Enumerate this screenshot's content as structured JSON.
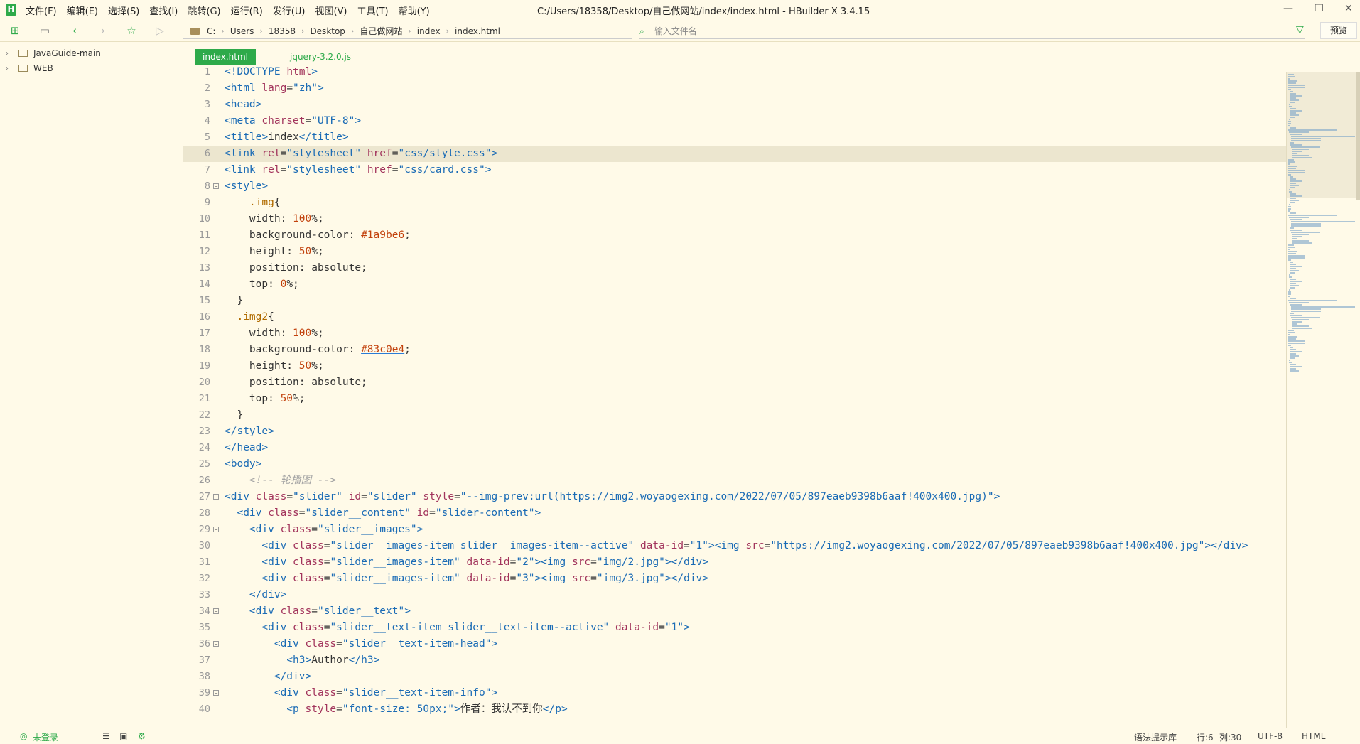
{
  "app": {
    "window_title": "C:/Users/18358/Desktop/自己做网站/index/index.html - HBuilder X 3.4.15",
    "logo_letter": "H"
  },
  "menu": [
    "文件(F)",
    "编辑(E)",
    "选择(S)",
    "查找(I)",
    "跳转(G)",
    "运行(R)",
    "发行(U)",
    "视图(V)",
    "工具(T)",
    "帮助(Y)"
  ],
  "toolbar": {
    "breadcrumb": [
      "C:",
      "Users",
      "18358",
      "Desktop",
      "自己做网站",
      "index",
      "index.html"
    ],
    "file_filter_placeholder": "输入文件名",
    "preview_label": "预览"
  },
  "sidebar": {
    "items": [
      {
        "label": "JavaGuide-main"
      },
      {
        "label": "WEB"
      }
    ]
  },
  "tabs": [
    {
      "label": "index.html",
      "active": true
    },
    {
      "label": "jquery-3.2.0.js",
      "active": false
    }
  ],
  "editor": {
    "current_line": 6,
    "lines": [
      {
        "n": "1",
        "fold": "",
        "tokens": [
          [
            "tg",
            "<!DOCTYPE "
          ],
          [
            "at",
            "html"
          ],
          [
            "tg",
            ">"
          ]
        ]
      },
      {
        "n": "2",
        "fold": "",
        "tokens": [
          [
            "tg",
            "<html "
          ],
          [
            "at",
            "lang"
          ],
          [
            "tx",
            "="
          ],
          [
            "st",
            "\"zh\""
          ],
          [
            "tg",
            ">"
          ]
        ]
      },
      {
        "n": "3",
        "fold": "",
        "tokens": [
          [
            "tg",
            "<head>"
          ]
        ]
      },
      {
        "n": "4",
        "fold": "",
        "tokens": [
          [
            "tg",
            "<meta "
          ],
          [
            "at",
            "charset"
          ],
          [
            "tx",
            "="
          ],
          [
            "st",
            "\"UTF-8\""
          ],
          [
            "tg",
            ">"
          ]
        ]
      },
      {
        "n": "5",
        "fold": "",
        "tokens": [
          [
            "tg",
            "<title>"
          ],
          [
            "tx",
            "index"
          ],
          [
            "tg",
            "</title>"
          ]
        ]
      },
      {
        "n": "6",
        "fold": "",
        "tokens": [
          [
            "tg",
            "<link "
          ],
          [
            "at",
            "rel"
          ],
          [
            "tx",
            "="
          ],
          [
            "st",
            "\"stylesheet\" "
          ],
          [
            "at",
            "href"
          ],
          [
            "tx",
            "="
          ],
          [
            "st",
            "\"css/style.css\""
          ],
          [
            "tg",
            ">"
          ]
        ]
      },
      {
        "n": "7",
        "fold": "",
        "tokens": [
          [
            "tg",
            "<link "
          ],
          [
            "at",
            "rel"
          ],
          [
            "tx",
            "="
          ],
          [
            "st",
            "\"stylesheet\" "
          ],
          [
            "at",
            "href"
          ],
          [
            "tx",
            "="
          ],
          [
            "st",
            "\"css/card.css\""
          ],
          [
            "tg",
            ">"
          ]
        ]
      },
      {
        "n": "8",
        "fold": "⊟",
        "tokens": [
          [
            "tg",
            "<style>"
          ]
        ]
      },
      {
        "n": "9",
        "fold": "",
        "tokens": [
          [
            "tx",
            "    "
          ],
          [
            "sel",
            ".img"
          ],
          [
            "tx",
            "{"
          ]
        ]
      },
      {
        "n": "10",
        "fold": "",
        "tokens": [
          [
            "tx",
            "    width: "
          ],
          [
            "num",
            "100"
          ],
          [
            "tx",
            "%;"
          ]
        ]
      },
      {
        "n": "11",
        "fold": "",
        "tokens": [
          [
            "tx",
            "    background-color: "
          ],
          [
            "clr",
            "#1a9be6"
          ],
          [
            "tx",
            ";"
          ]
        ]
      },
      {
        "n": "12",
        "fold": "",
        "tokens": [
          [
            "tx",
            "    height: "
          ],
          [
            "num",
            "50"
          ],
          [
            "tx",
            "%;"
          ]
        ]
      },
      {
        "n": "13",
        "fold": "",
        "tokens": [
          [
            "tx",
            "    position: absolute;"
          ]
        ]
      },
      {
        "n": "14",
        "fold": "",
        "tokens": [
          [
            "tx",
            "    top: "
          ],
          [
            "num",
            "0"
          ],
          [
            "tx",
            "%;"
          ]
        ]
      },
      {
        "n": "15",
        "fold": "",
        "tokens": [
          [
            "tx",
            "  }"
          ]
        ]
      },
      {
        "n": "16",
        "fold": "",
        "tokens": [
          [
            "tx",
            "  "
          ],
          [
            "sel",
            ".img2"
          ],
          [
            "tx",
            "{"
          ]
        ]
      },
      {
        "n": "17",
        "fold": "",
        "tokens": [
          [
            "tx",
            "    width: "
          ],
          [
            "num",
            "100"
          ],
          [
            "tx",
            "%;"
          ]
        ]
      },
      {
        "n": "18",
        "fold": "",
        "tokens": [
          [
            "tx",
            "    background-color: "
          ],
          [
            "clr",
            "#83c0e4"
          ],
          [
            "tx",
            ";"
          ]
        ]
      },
      {
        "n": "19",
        "fold": "",
        "tokens": [
          [
            "tx",
            "    height: "
          ],
          [
            "num",
            "50"
          ],
          [
            "tx",
            "%;"
          ]
        ]
      },
      {
        "n": "20",
        "fold": "",
        "tokens": [
          [
            "tx",
            "    position: absolute;"
          ]
        ]
      },
      {
        "n": "21",
        "fold": "",
        "tokens": [
          [
            "tx",
            "    top: "
          ],
          [
            "num",
            "50"
          ],
          [
            "tx",
            "%;"
          ]
        ]
      },
      {
        "n": "22",
        "fold": "",
        "tokens": [
          [
            "tx",
            "  }"
          ]
        ]
      },
      {
        "n": "23",
        "fold": "",
        "tokens": [
          [
            "tg",
            "</style>"
          ]
        ]
      },
      {
        "n": "24",
        "fold": "",
        "tokens": [
          [
            "tg",
            "</head>"
          ]
        ]
      },
      {
        "n": "25",
        "fold": "",
        "tokens": [
          [
            "tg",
            "<body>"
          ]
        ]
      },
      {
        "n": "26",
        "fold": "",
        "tokens": [
          [
            "cm",
            "    <!-- 轮播图 -->"
          ]
        ]
      },
      {
        "n": "27",
        "fold": "⊟",
        "tokens": [
          [
            "tg",
            "<div "
          ],
          [
            "at",
            "class"
          ],
          [
            "tx",
            "="
          ],
          [
            "st",
            "\"slider\" "
          ],
          [
            "at",
            "id"
          ],
          [
            "tx",
            "="
          ],
          [
            "st",
            "\"slider\" "
          ],
          [
            "at",
            "style"
          ],
          [
            "tx",
            "="
          ],
          [
            "st",
            "\"--img-prev:url(https://img2.woyaogexing.com/2022/07/05/897eaeb9398b6aaf!400x400.jpg)\""
          ],
          [
            "tg",
            ">"
          ]
        ]
      },
      {
        "n": "28",
        "fold": "",
        "tokens": [
          [
            "tx",
            "  "
          ],
          [
            "tg",
            "<div "
          ],
          [
            "at",
            "class"
          ],
          [
            "tx",
            "="
          ],
          [
            "st",
            "\"slider__content\" "
          ],
          [
            "at",
            "id"
          ],
          [
            "tx",
            "="
          ],
          [
            "st",
            "\"slider-content\""
          ],
          [
            "tg",
            ">"
          ]
        ]
      },
      {
        "n": "29",
        "fold": "⊟",
        "tokens": [
          [
            "tx",
            "    "
          ],
          [
            "tg",
            "<div "
          ],
          [
            "at",
            "class"
          ],
          [
            "tx",
            "="
          ],
          [
            "st",
            "\"slider__images\""
          ],
          [
            "tg",
            ">"
          ]
        ]
      },
      {
        "n": "30",
        "fold": "",
        "tokens": [
          [
            "tx",
            "      "
          ],
          [
            "tg",
            "<div "
          ],
          [
            "at",
            "class"
          ],
          [
            "tx",
            "="
          ],
          [
            "st",
            "\"slider__images-item slider__images-item--active\" "
          ],
          [
            "at",
            "data-id"
          ],
          [
            "tx",
            "="
          ],
          [
            "st",
            "\"1\""
          ],
          [
            "tg",
            "><img "
          ],
          [
            "at",
            "src"
          ],
          [
            "tx",
            "="
          ],
          [
            "st",
            "\"https://img2.woyaogexing.com/2022/07/05/897eaeb9398b6aaf!400x400.jpg\""
          ],
          [
            "tg",
            "></div>"
          ]
        ]
      },
      {
        "n": "31",
        "fold": "",
        "tokens": [
          [
            "tx",
            "      "
          ],
          [
            "tg",
            "<div "
          ],
          [
            "at",
            "class"
          ],
          [
            "tx",
            "="
          ],
          [
            "st",
            "\"slider__images-item\" "
          ],
          [
            "at",
            "data-id"
          ],
          [
            "tx",
            "="
          ],
          [
            "st",
            "\"2\""
          ],
          [
            "tg",
            "><img "
          ],
          [
            "at",
            "src"
          ],
          [
            "tx",
            "="
          ],
          [
            "st",
            "\"img/2.jpg\""
          ],
          [
            "tg",
            "></div>"
          ]
        ]
      },
      {
        "n": "32",
        "fold": "",
        "tokens": [
          [
            "tx",
            "      "
          ],
          [
            "tg",
            "<div "
          ],
          [
            "at",
            "class"
          ],
          [
            "tx",
            "="
          ],
          [
            "st",
            "\"slider__images-item\" "
          ],
          [
            "at",
            "data-id"
          ],
          [
            "tx",
            "="
          ],
          [
            "st",
            "\"3\""
          ],
          [
            "tg",
            "><img "
          ],
          [
            "at",
            "src"
          ],
          [
            "tx",
            "="
          ],
          [
            "st",
            "\"img/3.jpg\""
          ],
          [
            "tg",
            "></div>"
          ]
        ]
      },
      {
        "n": "33",
        "fold": "",
        "tokens": [
          [
            "tx",
            "    "
          ],
          [
            "tg",
            "</div>"
          ]
        ]
      },
      {
        "n": "34",
        "fold": "⊟",
        "tokens": [
          [
            "tx",
            "    "
          ],
          [
            "tg",
            "<div "
          ],
          [
            "at",
            "class"
          ],
          [
            "tx",
            "="
          ],
          [
            "st",
            "\"slider__text\""
          ],
          [
            "tg",
            ">"
          ]
        ]
      },
      {
        "n": "35",
        "fold": "",
        "tokens": [
          [
            "tx",
            "      "
          ],
          [
            "tg",
            "<div "
          ],
          [
            "at",
            "class"
          ],
          [
            "tx",
            "="
          ],
          [
            "st",
            "\"slider__text-item slider__text-item--active\" "
          ],
          [
            "at",
            "data-id"
          ],
          [
            "tx",
            "="
          ],
          [
            "st",
            "\"1\""
          ],
          [
            "tg",
            ">"
          ]
        ]
      },
      {
        "n": "36",
        "fold": "⊟",
        "tokens": [
          [
            "tx",
            "        "
          ],
          [
            "tg",
            "<div "
          ],
          [
            "at",
            "class"
          ],
          [
            "tx",
            "="
          ],
          [
            "st",
            "\"slider__text-item-head\""
          ],
          [
            "tg",
            ">"
          ]
        ]
      },
      {
        "n": "37",
        "fold": "",
        "tokens": [
          [
            "tx",
            "          "
          ],
          [
            "tg",
            "<h3>"
          ],
          [
            "tx",
            "Author"
          ],
          [
            "tg",
            "</h3>"
          ]
        ]
      },
      {
        "n": "38",
        "fold": "",
        "tokens": [
          [
            "tx",
            "        "
          ],
          [
            "tg",
            "</div>"
          ]
        ]
      },
      {
        "n": "39",
        "fold": "⊟",
        "tokens": [
          [
            "tx",
            "        "
          ],
          [
            "tg",
            "<div "
          ],
          [
            "at",
            "class"
          ],
          [
            "tx",
            "="
          ],
          [
            "st",
            "\"slider__text-item-info\""
          ],
          [
            "tg",
            ">"
          ]
        ]
      },
      {
        "n": "40",
        "fold": "",
        "tokens": [
          [
            "tx",
            "          "
          ],
          [
            "tg",
            "<p "
          ],
          [
            "at",
            "style"
          ],
          [
            "tx",
            "="
          ],
          [
            "st",
            "\"font-size: 50px;\""
          ],
          [
            "tg",
            ">"
          ],
          [
            "tx",
            "作者：我认不到你"
          ],
          [
            "tg",
            "</p>"
          ]
        ]
      }
    ]
  },
  "statusbar": {
    "login": "未登录",
    "syntax_hint": "语法提示库",
    "row": "行:6",
    "col": "列:30",
    "encoding": "UTF-8",
    "language": "HTML"
  },
  "colors": {
    "accent": "#2eaa4a",
    "background": "#fffae8",
    "current_line": "#ece6cf"
  }
}
